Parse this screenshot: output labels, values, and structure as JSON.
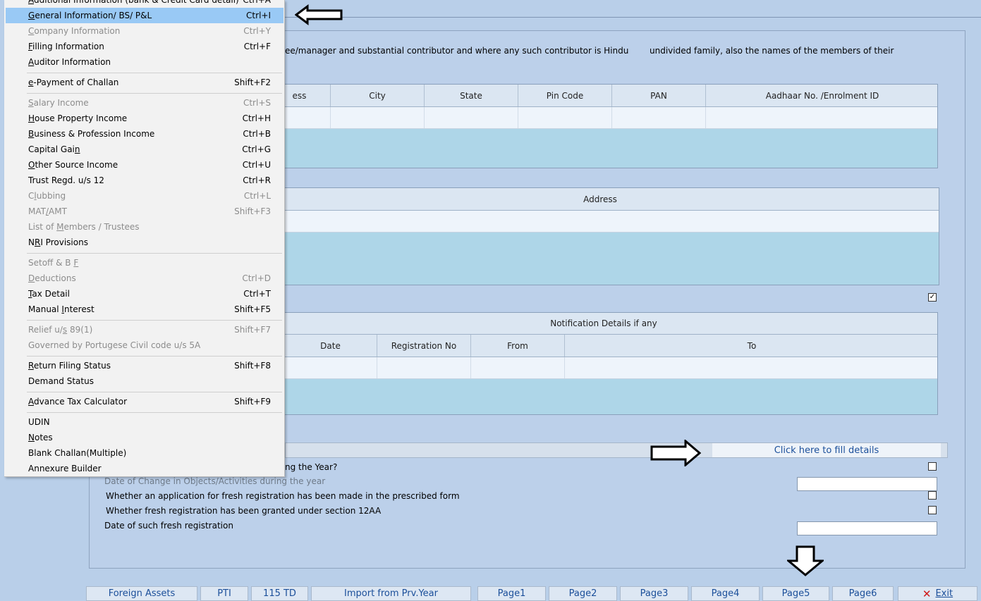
{
  "menu": {
    "items": [
      {
        "label": "Additional Information (bank & Credit Card detail)",
        "shortcut": "Ctrl+A",
        "disabled": false,
        "selected": false
      },
      {
        "label": "General Information/ BS/ P&L",
        "shortcut": "Ctrl+I",
        "disabled": false,
        "selected": true
      },
      {
        "label": "Company Information",
        "shortcut": "Ctrl+Y",
        "disabled": true,
        "selected": false
      },
      {
        "label": "Filling Information",
        "shortcut": "Ctrl+F",
        "disabled": false,
        "selected": false
      },
      {
        "label": "Auditor Information",
        "shortcut": "",
        "disabled": false,
        "selected": false
      },
      {
        "label": "e-Payment of Challan",
        "shortcut": "Shift+F2",
        "disabled": false,
        "selected": false
      },
      {
        "label": "Salary Income",
        "shortcut": "Ctrl+S",
        "disabled": true,
        "selected": false
      },
      {
        "label": "House Property Income",
        "shortcut": "Ctrl+H",
        "disabled": false,
        "selected": false
      },
      {
        "label": "Business & Profession Income",
        "shortcut": "Ctrl+B",
        "disabled": false,
        "selected": false
      },
      {
        "label": "Capital Gain",
        "shortcut": "Ctrl+G",
        "disabled": false,
        "selected": false
      },
      {
        "label": "Other Source Income",
        "shortcut": "Ctrl+U",
        "disabled": false,
        "selected": false
      },
      {
        "label": "Trust Regd. u/s 12",
        "shortcut": "Ctrl+R",
        "disabled": false,
        "selected": false
      },
      {
        "label": "Clubbing",
        "shortcut": "Ctrl+L",
        "disabled": true,
        "selected": false
      },
      {
        "label": "MAT/AMT",
        "shortcut": "Shift+F3",
        "disabled": true,
        "selected": false
      },
      {
        "label": "List of Members / Trustees",
        "shortcut": "",
        "disabled": true,
        "selected": false
      },
      {
        "label": "NRI Provisions",
        "shortcut": "",
        "disabled": false,
        "selected": false
      },
      {
        "label": "Setoff & B F",
        "shortcut": "",
        "disabled": true,
        "selected": false
      },
      {
        "label": "Deductions",
        "shortcut": "Ctrl+D",
        "disabled": true,
        "selected": false
      },
      {
        "label": "Tax Detail",
        "shortcut": "Ctrl+T",
        "disabled": false,
        "selected": false
      },
      {
        "label": "Manual Interest",
        "shortcut": "Shift+F5",
        "disabled": false,
        "selected": false
      },
      {
        "label": "Relief u/s 89(1)",
        "shortcut": "Shift+F7",
        "disabled": true,
        "selected": false
      },
      {
        "label": "Governed by Portugese Civil code u/s 5A",
        "shortcut": "",
        "disabled": true,
        "selected": false
      },
      {
        "label": "Return Filing Status",
        "shortcut": "Shift+F8",
        "disabled": false,
        "selected": false
      },
      {
        "label": "Demand Status",
        "shortcut": "",
        "disabled": false,
        "selected": false
      },
      {
        "label": "Advance Tax Calculator",
        "shortcut": "Shift+F9",
        "disabled": false,
        "selected": false
      },
      {
        "label": "UDIN",
        "shortcut": "",
        "disabled": false,
        "selected": false
      },
      {
        "label": "Notes",
        "shortcut": "",
        "disabled": false,
        "selected": false
      },
      {
        "label": "Blank Challan(Multiple)",
        "shortcut": "",
        "disabled": false,
        "selected": false
      },
      {
        "label": "Annexure Builder",
        "shortcut": "",
        "disabled": false,
        "selected": false
      }
    ]
  },
  "form": {
    "description_part1": "ee/manager and substantial contributor and where any such contributor is Hindu",
    "description_part2": "undivided family, also the names of the members of their",
    "contributors_grid": {
      "headers": [
        "ess",
        "City",
        "State",
        "Pin Code",
        "PAN",
        "Aadhaar No. /Enrolment ID"
      ]
    },
    "address_grid": {
      "header": "Address"
    },
    "checkbox_checked": true,
    "notification_grid": {
      "caption": "Notification Details if any",
      "headers": [
        "Date",
        "Registration No",
        "From",
        "To"
      ]
    },
    "fill_details_button": "Click here to fill details",
    "rows": [
      {
        "label": "ng the Year?",
        "type": "checkbox",
        "checked": false
      },
      {
        "label": "Date of Change in Objects/Activities during the year",
        "type": "date",
        "value": "",
        "disabled": true
      },
      {
        "label": "Whether an application for fresh registration has been made in the prescribed form",
        "type": "checkbox",
        "checked": false
      },
      {
        "label": "Whether fresh registration has been granted under section 12AA",
        "type": "checkbox",
        "checked": false
      },
      {
        "label": "Date of such fresh registration",
        "type": "date",
        "value": ""
      }
    ]
  },
  "bottom_buttons": {
    "foreign_assets": "Foreign Assets",
    "pti": "PTI",
    "td115": "115 TD",
    "import_prev": "Import from Prv.Year",
    "page1": "Page1",
    "page2": "Page2",
    "page3": "Page3",
    "page4": "Page4",
    "page5": "Page5",
    "page6": "Page6",
    "exit": "Exit"
  },
  "colors": {
    "background": "#b9cfe9",
    "menu_selected": "#99c9f5",
    "grid_fill": "#aed6e8",
    "button_text": "#1b4f9a"
  }
}
